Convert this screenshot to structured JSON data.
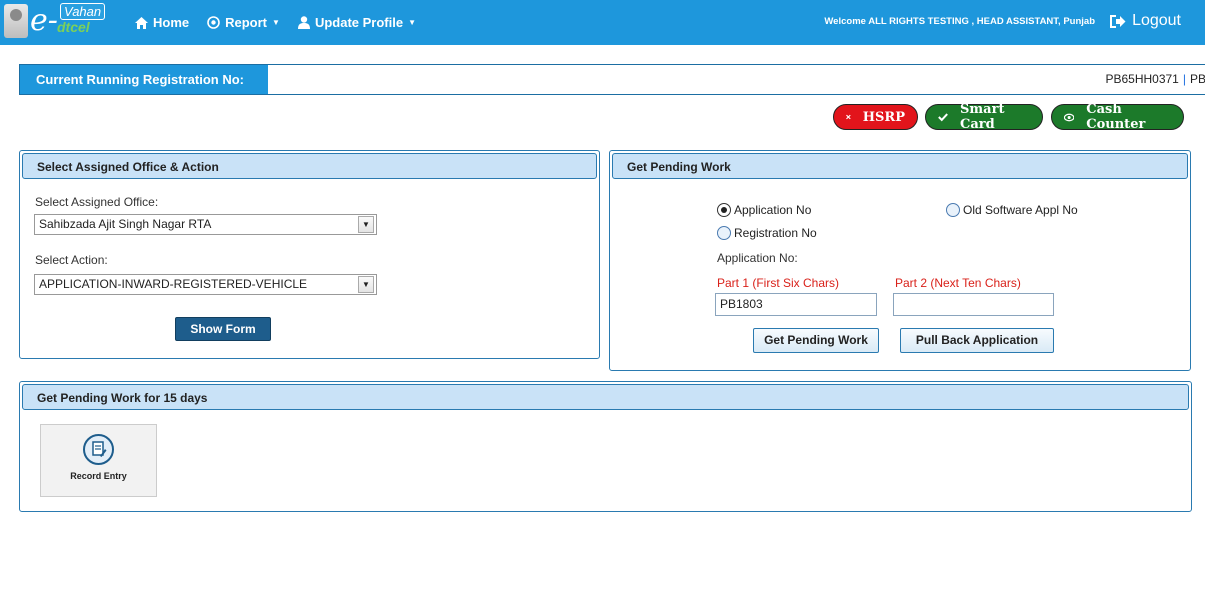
{
  "header": {
    "logo_e": "e-",
    "logo_top": "Vahan",
    "logo_bottom": "dtcel",
    "nav": [
      {
        "label": "Home",
        "icon": "home-icon",
        "has_caret": false
      },
      {
        "label": "Report",
        "icon": "circle-arrow-icon",
        "has_caret": true
      },
      {
        "label": "Update Profile",
        "icon": "user-icon",
        "has_caret": true
      }
    ],
    "welcome": "Welcome ALL RIGHTS TESTING , HEAD ASSISTANT, Punjab",
    "logout": "Logout",
    "colors": {
      "bar": "#1e97dc"
    }
  },
  "registration": {
    "label": "Current Running Registration No:",
    "value": "PB65HH0371",
    "value_cut": "PB("
  },
  "actions": [
    {
      "label": "HSRP",
      "icon": "close-icon",
      "color": "#e2141b"
    },
    {
      "label": "Smart Card",
      "icon": "check-icon",
      "color": "#1c7a2a"
    },
    {
      "label": "Cash Counter",
      "icon": "eye-icon",
      "color": "#1c7a2a"
    }
  ],
  "office_panel": {
    "title": "Select Assigned Office & Action",
    "office_label": "Select Assigned Office:",
    "office_value": "Sahibzada Ajit Singh Nagar RTA",
    "action_label": "Select Action:",
    "action_value": "APPLICATION-INWARD-REGISTERED-VEHICLE",
    "show_form": "Show Form"
  },
  "pending_panel": {
    "title": "Get Pending Work",
    "radio_app": "Application No",
    "radio_old": "Old Software Appl No",
    "radio_reg": "Registration No",
    "appno_label": "Application No:",
    "part1_label": "Part 1 (First Six Chars)",
    "part2_label": "Part 2 (Next Ten Chars)",
    "part1_value": "PB1803",
    "part2_value": "",
    "get_pending": "Get Pending Work",
    "pull_back": "Pull Back Application"
  },
  "days_panel": {
    "title": "Get Pending Work for 15 days",
    "tile_label": "Record Entry"
  }
}
